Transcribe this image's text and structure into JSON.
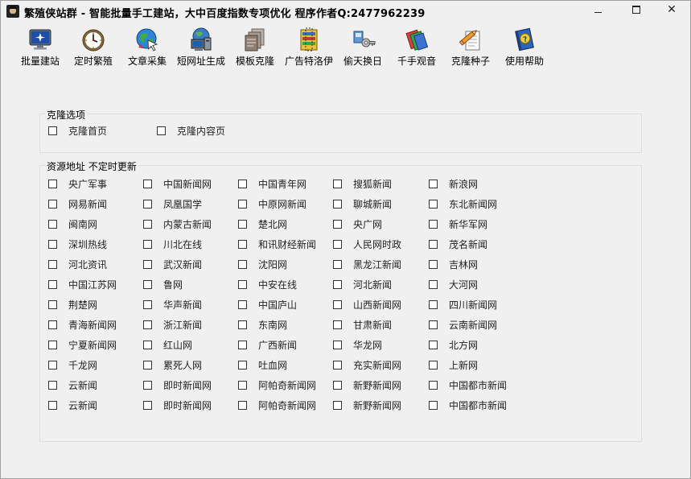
{
  "window": {
    "title": "繁殖侠站群 - 智能批量手工建站，大中百度指数专项优化 程序作者Q:2477962239",
    "minimize": "—",
    "maximize": "□",
    "close": "✕"
  },
  "toolbar": [
    {
      "label": "批量建站",
      "icon": "monitor-icon"
    },
    {
      "label": "定时繁殖",
      "icon": "clock-icon"
    },
    {
      "label": "文章采集",
      "icon": "globe-cursor-icon"
    },
    {
      "label": "短网址生成",
      "icon": "network-computer-icon"
    },
    {
      "label": "模板克隆",
      "icon": "documents-icon"
    },
    {
      "label": "广告特洛伊",
      "icon": "archive-icon"
    },
    {
      "label": "偷天换日",
      "icon": "keys-icon"
    },
    {
      "label": "千手观音",
      "icon": "cards-icon"
    },
    {
      "label": "克隆种子",
      "icon": "pencil-paper-icon"
    },
    {
      "label": "使用帮助",
      "icon": "help-book-icon"
    }
  ],
  "clone_options": {
    "title": "克隆选项",
    "items": [
      {
        "label": "克隆首页",
        "checked": false
      },
      {
        "label": "克隆内容页",
        "checked": false
      }
    ]
  },
  "sources": {
    "title": "资源地址  不定时更新",
    "rows": [
      [
        "央广军事",
        "中国新闻网",
        "中国青年网",
        "搜狐新闻",
        "新浪网"
      ],
      [
        "网易新闻",
        "凤凰国学",
        "中原网新闻",
        "聊城新闻",
        "东北新闻网"
      ],
      [
        "闽南网",
        "内蒙古新闻",
        "楚北网",
        "央广网",
        "新华军网"
      ],
      [
        "深圳热线",
        "川北在线",
        "和讯财经新闻",
        "人民网时政",
        "茂名新闻"
      ],
      [
        "河北资讯",
        "武汉新闻",
        "沈阳网",
        "黑龙江新闻",
        "吉林网"
      ],
      [
        "中国江苏网",
        "鲁网",
        "中安在线",
        "河北新闻",
        "大河网"
      ],
      [
        "荆楚网",
        "华声新闻",
        "中国庐山",
        "山西新闻网",
        "四川新闻网"
      ],
      [
        "青海新闻网",
        "浙江新闻",
        "东南网",
        "甘肃新闻",
        "云南新闻网"
      ],
      [
        "宁夏新闻网",
        "红山网",
        "广西新闻",
        "华龙网",
        "北方网"
      ],
      [
        "千龙网",
        "累死人网",
        "吐血网",
        "充实新闻网",
        "上新网"
      ],
      [
        "云新闻",
        "即时新闻网",
        "阿帕奇新闻网",
        "新野新闻网",
        "中国都市新闻"
      ],
      [
        "云新闻",
        "即时新闻网",
        "阿帕奇新闻网",
        "新野新闻网",
        "中国都市新闻"
      ]
    ]
  }
}
